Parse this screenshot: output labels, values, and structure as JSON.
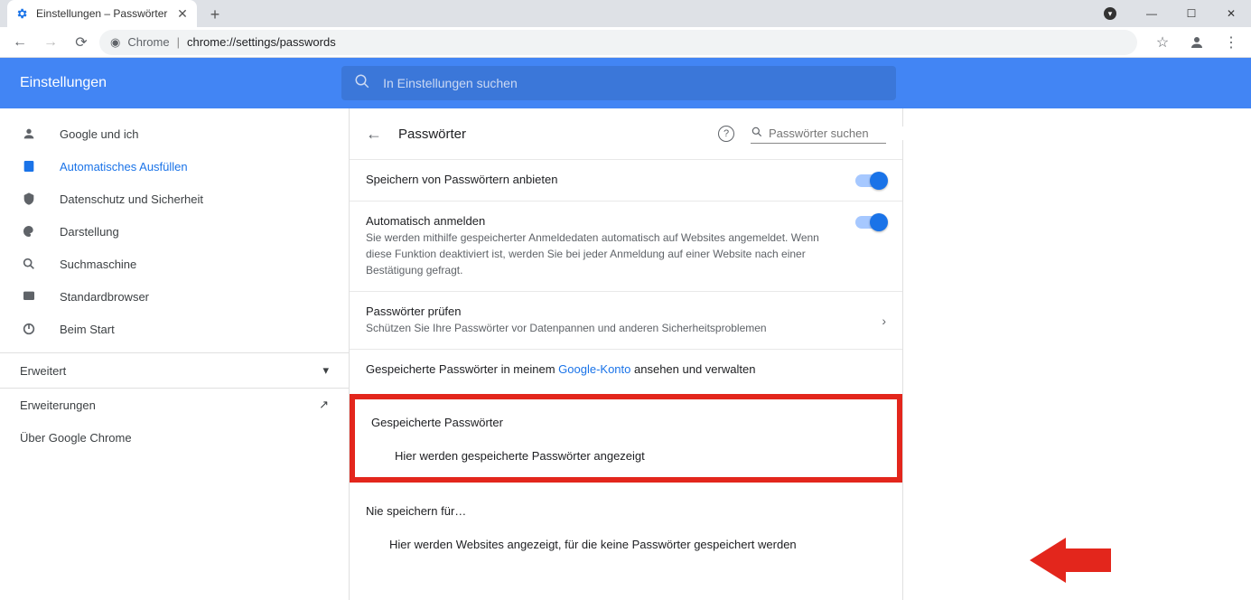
{
  "browser": {
    "tab_title": "Einstellungen – Passwörter",
    "url_label": "Chrome",
    "url_path": "chrome://settings/passwords"
  },
  "header": {
    "title": "Einstellungen",
    "search_placeholder": "In Einstellungen suchen"
  },
  "sidebar": {
    "items": [
      {
        "label": "Google und ich"
      },
      {
        "label": "Automatisches Ausfüllen"
      },
      {
        "label": "Datenschutz und Sicherheit"
      },
      {
        "label": "Darstellung"
      },
      {
        "label": "Suchmaschine"
      },
      {
        "label": "Standardbrowser"
      },
      {
        "label": "Beim Start"
      }
    ],
    "advanced": "Erweitert",
    "extensions": "Erweiterungen",
    "about": "Über Google Chrome"
  },
  "content": {
    "title": "Passwörter",
    "search_placeholder": "Passwörter suchen",
    "offer_save": "Speichern von Passwörtern anbieten",
    "auto_signin_label": "Automatisch anmelden",
    "auto_signin_desc": "Sie werden mithilfe gespeicherter Anmeldedaten automatisch auf Websites angemeldet. Wenn diese Funktion deaktiviert ist, werden Sie bei jeder Anmeldung auf einer Website nach einer Bestätigung gefragt.",
    "check_label": "Passwörter prüfen",
    "check_desc": "Schützen Sie Ihre Passwörter vor Datenpannen und anderen Sicherheitsproblemen",
    "view_prefix": "Gespeicherte Passwörter in meinem ",
    "view_link": "Google-Konto",
    "view_suffix": " ansehen und verwalten",
    "saved_header": "Gespeicherte Passwörter",
    "saved_empty": "Hier werden gespeicherte Passwörter angezeigt",
    "never_header": "Nie speichern für…",
    "never_empty": "Hier werden Websites angezeigt, für die keine Passwörter gespeichert werden"
  }
}
